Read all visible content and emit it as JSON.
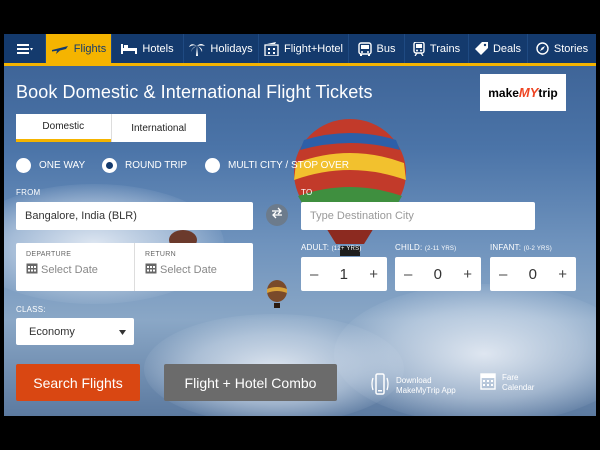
{
  "nav": {
    "items": [
      {
        "label": "Flights",
        "icon": "plane-icon"
      },
      {
        "label": "Hotels",
        "icon": "bed-icon"
      },
      {
        "label": "Holidays",
        "icon": "palm-tree-icon"
      },
      {
        "label": "Flight+Hotel",
        "icon": "flight-hotel-icon"
      },
      {
        "label": "Bus",
        "icon": "bus-icon"
      },
      {
        "label": "Trains",
        "icon": "train-icon"
      },
      {
        "label": "Deals",
        "icon": "tag-icon"
      },
      {
        "label": "Stories",
        "icon": "compass-icon"
      }
    ],
    "active": "Flights"
  },
  "header": {
    "title": "Book Domestic & International Flight Tickets",
    "logo_text_a": "make",
    "logo_text_b": "MY",
    "logo_text_c": "trip"
  },
  "trip_tabs": [
    "Domestic",
    "International"
  ],
  "trip_types": [
    "ONE WAY",
    "ROUND TRIP",
    "MULTI CITY / STOP OVER"
  ],
  "selected_trip_type": "ROUND TRIP",
  "form": {
    "from_label": "FROM",
    "from_value": "Bangalore, India (BLR)",
    "to_label": "TO",
    "to_placeholder": "Type Destination City",
    "departure_label": "DEPARTURE",
    "departure_placeholder": "Select Date",
    "return_label": "RETURN",
    "return_placeholder": "Select Date",
    "adult_label": "ADULT:",
    "adult_hint": "(12+ YRS)",
    "adult_value": "1",
    "child_label": "CHILD:",
    "child_hint": "(2-11 YRS)",
    "child_value": "0",
    "infant_label": "INFANT:",
    "infant_hint": "(0-2 YRS)",
    "infant_value": "0",
    "class_label": "CLASS:",
    "class_value": "Economy"
  },
  "buttons": {
    "search": "Search Flights",
    "combo": "Flight + Hotel Combo"
  },
  "promos": {
    "app_line1": "Download",
    "app_line2": "MakeMyTrip App",
    "cal_line1": "Fare",
    "cal_line2": "Calendar"
  },
  "colors": {
    "nav_bg": "#143a6d",
    "accent": "#f5b400",
    "search_button": "#d94712",
    "combo_button": "#6b6b6b"
  }
}
